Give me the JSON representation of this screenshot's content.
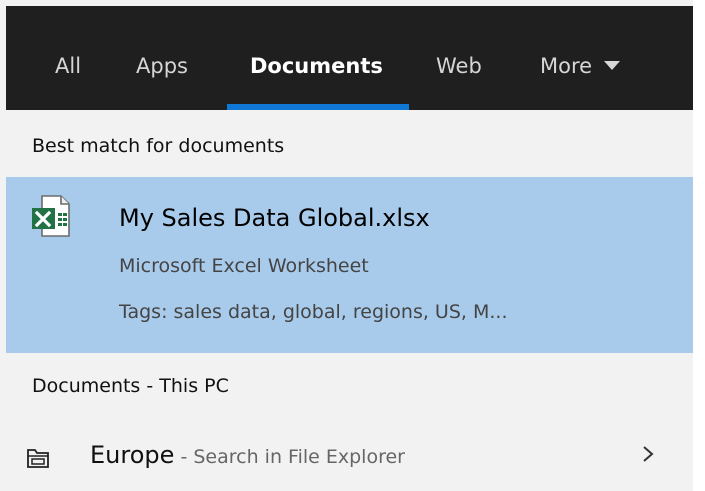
{
  "tabs": [
    {
      "label": "All"
    },
    {
      "label": "Apps"
    },
    {
      "label": "Documents",
      "active": true
    },
    {
      "label": "Web"
    },
    {
      "label": "More"
    }
  ],
  "best_match": {
    "section_title": "Best match for documents",
    "item": {
      "title": "My Sales Data Global.xlsx",
      "type": "Microsoft Excel Worksheet",
      "tags": "Tags: sales data, global, regions, US, M...",
      "icon": "excel-file-icon"
    }
  },
  "this_pc": {
    "section_title": "Documents - This PC",
    "item": {
      "name": "Europe",
      "separator": " - ",
      "hint": "Search in File Explorer",
      "icon": "folder-icon"
    }
  },
  "colors": {
    "tabbar_bg": "#1f1f1f",
    "accent": "#0e78d4",
    "selected_bg": "#a9cbeb",
    "panel_bg": "#f2f2f2",
    "excel_green": "#217346"
  }
}
